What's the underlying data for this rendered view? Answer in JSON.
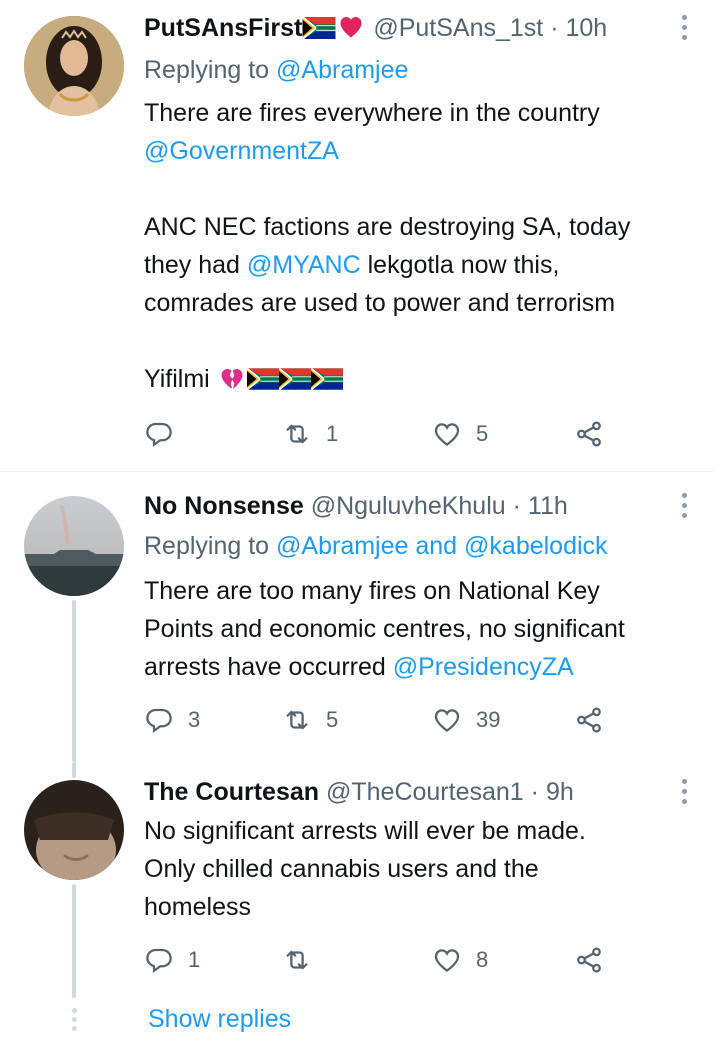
{
  "colors": {
    "accent": "#1d9bf0",
    "secondary_text": "#536471",
    "thread_line": "#cfd9de"
  },
  "tweets": [
    {
      "display_name": "PutSAnsFirst",
      "name_emoji": "flag-south-africa, red-heart",
      "handle": "@PutSAns_1st",
      "separator": "·",
      "time": "10h",
      "replying_label": "Replying to",
      "replying_users": [
        "@Abramjee"
      ],
      "text_lines": [
        "There are fires everywhere in the country",
        "@GovernmentZA",
        "",
        "ANC NEC factions are destroying SA, today",
        "they had @MYANC lekgotla now this,",
        "comrades are used to power and terrorism",
        "",
        "Yifilmi"
      ],
      "p1_line1": "There are fires everywhere in the country",
      "p1_mention": "@GovernmentZA",
      "p2_line1": "ANC NEC factions are destroying SA, today",
      "p2_line2a": "they had ",
      "p2_mention": "@MYANC",
      "p2_line2b": " lekgotla now this,",
      "p2_line3": "comrades are used to power and terrorism",
      "p3_text": "Yifilmi",
      "p3_emoji": "broken-heart, flag-south-africa x3",
      "replies": "",
      "retweets": "1",
      "likes": "5"
    },
    {
      "display_name": "No Nonsense",
      "handle": "@NguluvheKhulu",
      "separator": "·",
      "time": "11h",
      "replying_label": "Replying to",
      "replying_users": [
        "@Abramjee",
        "@kabelodick"
      ],
      "replying_and": "and",
      "line1": "There are too many fires on National Key",
      "line2": "Points and economic centres, no significant",
      "line3a": "arrests have occurred ",
      "line3_mention": "@PresidencyZA",
      "replies": "3",
      "retweets": "5",
      "likes": "39"
    },
    {
      "display_name": "The Courtesan",
      "handle": "@TheCourtesan1",
      "separator": "·",
      "time": "9h",
      "line1": "No significant arrests will ever be made.",
      "line2": "Only chilled cannabis users and the",
      "line3": "homeless",
      "replies": "1",
      "retweets": "",
      "likes": "8"
    }
  ],
  "show_replies_label": "Show replies",
  "icons": [
    "reply-icon",
    "retweet-icon",
    "like-icon",
    "share-icon",
    "more-icon"
  ]
}
